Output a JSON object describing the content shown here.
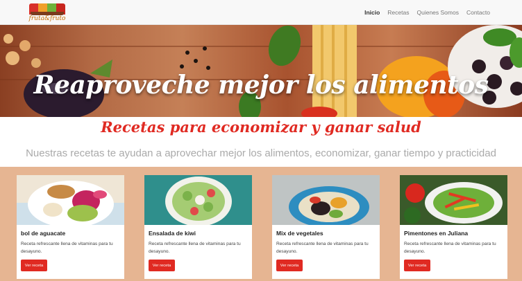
{
  "brand": {
    "logo_text": "fruta&fruto"
  },
  "nav": {
    "items": [
      {
        "label": "Inicio",
        "active": true
      },
      {
        "label": "Recetas",
        "active": false
      },
      {
        "label": "Quienes Somos",
        "active": false
      },
      {
        "label": "Contacto",
        "active": false
      }
    ]
  },
  "hero": {
    "title": "Reaproveche mejor los alimentos"
  },
  "intro": {
    "subtitle": "Recetas para economizar y ganar salud",
    "lead": "Nuestras recetas te ayudan a aprovechar mejor los alimentos, economizar, ganar tiempo y practicidad"
  },
  "cards": [
    {
      "title": "bol de aguacate",
      "text": "Receta refrescante llena de vitaminas para tu desayuno.",
      "button": "Ver receta"
    },
    {
      "title": "Ensalada de kiwi",
      "text": "Receta refrescante llena de vitaminas para tu desayuno.",
      "button": "Ver receta"
    },
    {
      "title": "Mix de vegetales",
      "text": "Receta refrescante llena de vitaminas para tu desayuno.",
      "button": "Ver receta"
    },
    {
      "title": "Pimentones en Juliana",
      "text": "Receta refrescante llena de vitaminas para tu desayuno.",
      "button": "Ver receta"
    }
  ],
  "colors": {
    "accent": "#e02a22",
    "band": "#e6b592",
    "navbar": "#f8f8f8"
  }
}
